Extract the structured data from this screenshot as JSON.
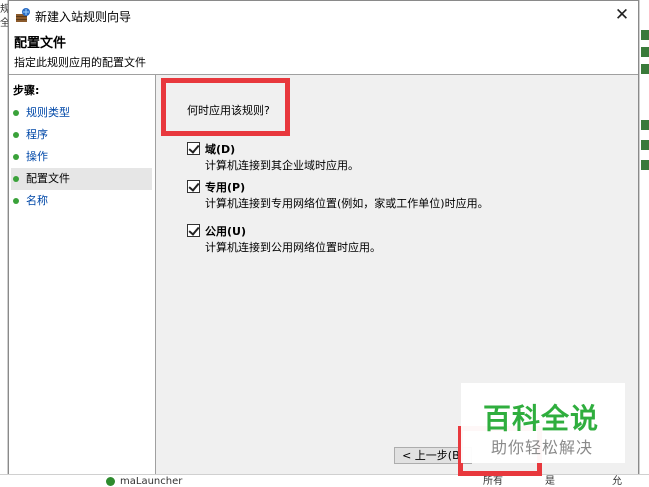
{
  "window": {
    "title": "新建入站规则向导",
    "close_symbol": "✕"
  },
  "header": {
    "title": "配置文件",
    "subtitle": "指定此规则应用的配置文件"
  },
  "steps": {
    "title": "步骤:",
    "items": [
      {
        "label": "规则类型"
      },
      {
        "label": "程序"
      },
      {
        "label": "操作"
      },
      {
        "label": "配置文件"
      },
      {
        "label": "名称"
      }
    ]
  },
  "content": {
    "question": "何时应用该规则?",
    "options": [
      {
        "label": "域(D)",
        "description": "计算机连接到其企业域时应用。",
        "checked": true
      },
      {
        "label": "专用(P)",
        "description": "计算机连接到专用网络位置(例如，家或工作单位)时应用。",
        "checked": true
      },
      {
        "label": "公用(U)",
        "description": "计算机连接到公用网络位置时应用。",
        "checked": true
      }
    ]
  },
  "buttons": {
    "back_label": "< 上一步(B)"
  },
  "watermark": {
    "main": "百科全说",
    "sub": "助你轻松解决"
  },
  "background": {
    "left_fragment_1": "规",
    "left_fragment_2": "全",
    "bottom_app": "maLauncher",
    "bottom_col1": "所有",
    "bottom_col2": "是",
    "bottom_col3": "允"
  },
  "colors": {
    "highlight_box": "#e8383d",
    "step_link": "#0048a8",
    "step_dot": "#3aa23a",
    "watermark_green": "#2fae3e"
  }
}
